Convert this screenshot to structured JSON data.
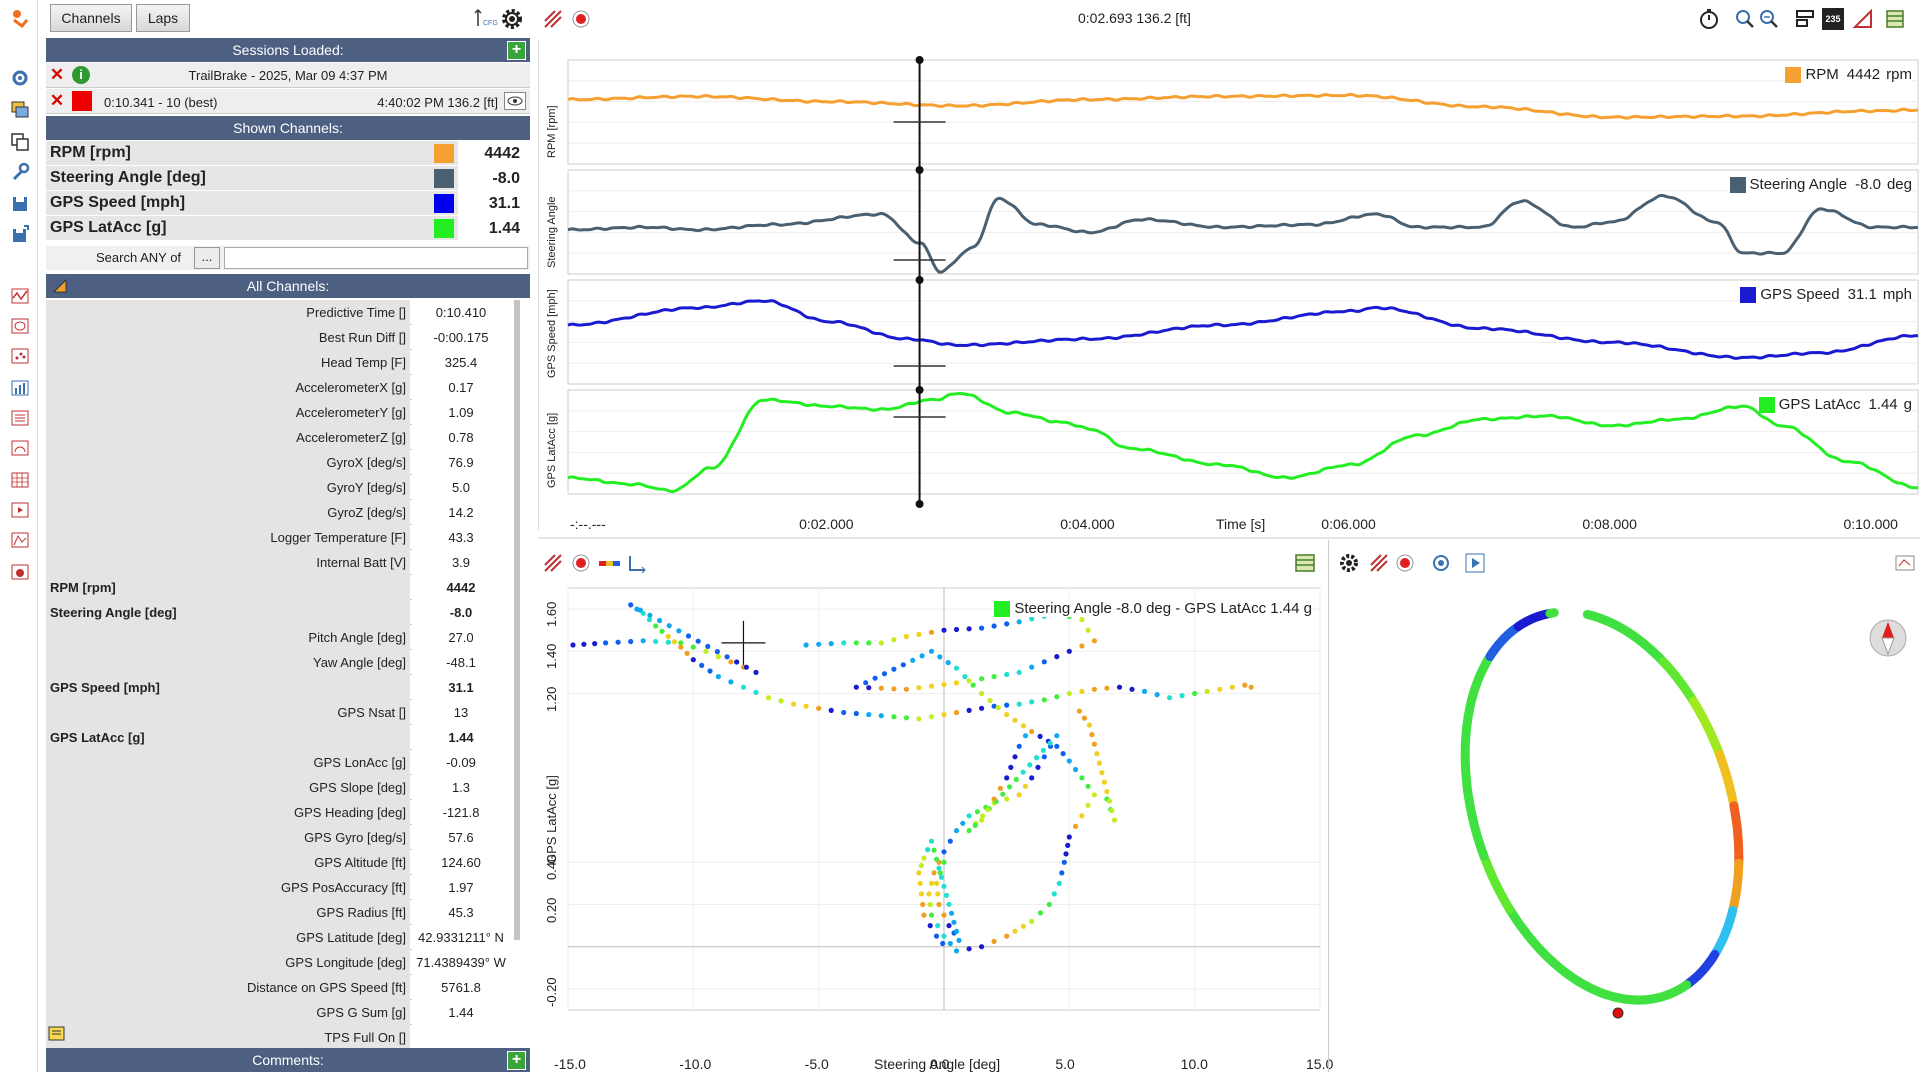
{
  "tabs": {
    "channels": "Channels",
    "laps": "Laps"
  },
  "cfg_label": "CFG",
  "sessions_header": "Sessions Loaded:",
  "session": {
    "name": "TrailBrake - 2025, Mar 09 4:37 PM",
    "lap": "0:10.341 - 10 (best)",
    "cursor": "4:40:02 PM 136.2 [ft]"
  },
  "shown_header": "Shown Channels:",
  "shown_channels": [
    {
      "name": "RPM [rpm]",
      "value": "4442",
      "color": "#f5a030"
    },
    {
      "name": "Steering Angle [deg]",
      "value": "-8.0",
      "color": "#4a6070"
    },
    {
      "name": "GPS Speed [mph]",
      "value": "31.1",
      "color": "#0000ee"
    },
    {
      "name": "GPS LatAcc [g]",
      "value": "1.44",
      "color": "#22ee22"
    }
  ],
  "search": {
    "label": "Search ANY of",
    "button": "...",
    "value": ""
  },
  "all_header": "All Channels:",
  "all_channels": [
    {
      "name": "Predictive Time []",
      "value": "0:10.410",
      "bold": false
    },
    {
      "name": "Best Run Diff []",
      "value": "-0:00.175",
      "bold": false
    },
    {
      "name": "Head Temp [F]",
      "value": "325.4",
      "bold": false
    },
    {
      "name": "AccelerometerX [g]",
      "value": "0.17",
      "bold": false
    },
    {
      "name": "AccelerometerY [g]",
      "value": "1.09",
      "bold": false
    },
    {
      "name": "AccelerometerZ [g]",
      "value": "0.78",
      "bold": false
    },
    {
      "name": "GyroX [deg/s]",
      "value": "76.9",
      "bold": false
    },
    {
      "name": "GyroY [deg/s]",
      "value": "5.0",
      "bold": false
    },
    {
      "name": "GyroZ [deg/s]",
      "value": "14.2",
      "bold": false
    },
    {
      "name": "Logger Temperature [F]",
      "value": "43.3",
      "bold": false
    },
    {
      "name": "Internal Batt [V]",
      "value": "3.9",
      "bold": false
    },
    {
      "name": "RPM [rpm]",
      "value": "4442",
      "bold": true
    },
    {
      "name": "Steering Angle [deg]",
      "value": "-8.0",
      "bold": true
    },
    {
      "name": "Pitch Angle [deg]",
      "value": "27.0",
      "bold": false
    },
    {
      "name": "Yaw Angle [deg]",
      "value": "-48.1",
      "bold": false
    },
    {
      "name": "GPS Speed [mph]",
      "value": "31.1",
      "bold": true
    },
    {
      "name": "GPS Nsat []",
      "value": "13",
      "bold": false
    },
    {
      "name": "GPS LatAcc [g]",
      "value": "1.44",
      "bold": true
    },
    {
      "name": "GPS LonAcc [g]",
      "value": "-0.09",
      "bold": false
    },
    {
      "name": "GPS Slope [deg]",
      "value": "1.3",
      "bold": false
    },
    {
      "name": "GPS Heading [deg]",
      "value": "-121.8",
      "bold": false
    },
    {
      "name": "GPS Gyro [deg/s]",
      "value": "57.6",
      "bold": false
    },
    {
      "name": "GPS Altitude [ft]",
      "value": "124.60",
      "bold": false
    },
    {
      "name": "GPS PosAccuracy [ft]",
      "value": "1.97",
      "bold": false
    },
    {
      "name": "GPS Radius [ft]",
      "value": "45.3",
      "bold": false
    },
    {
      "name": "GPS Latitude [deg]",
      "value": "42.9331211° N",
      "bold": false
    },
    {
      "name": "GPS Longitude [deg]",
      "value": "71.4389439° W",
      "bold": false
    },
    {
      "name": "Distance on GPS Speed [ft]",
      "value": "5761.8",
      "bold": false
    },
    {
      "name": "GPS G Sum [g]",
      "value": "1.44",
      "bold": false
    },
    {
      "name": "TPS Full On []",
      "value": "",
      "bold": false
    }
  ],
  "comments_header": "Comments:",
  "top_readout": "0:02.693 136.2 [ft]",
  "top_badge": "235",
  "time_plot": {
    "xlabel": "Time [s]",
    "x_ticks": [
      "-:--.---",
      "0:02.000",
      "0:04.000",
      "0:06.000",
      "0:08.000",
      "0:10.000"
    ],
    "xlim": [
      0,
      10.341
    ],
    "cursor_time": 2.693,
    "panels": [
      {
        "ylabel": "RPM [rpm]",
        "legend": {
          "name": "RPM",
          "value": "4442",
          "unit": "rpm"
        },
        "color": "#f5a030",
        "ylim": [
          4000,
          5000
        ]
      },
      {
        "ylabel": "Steering Angle",
        "legend": {
          "name": "Steering Angle",
          "value": "-8.0",
          "unit": "deg"
        },
        "color": "#4a6070",
        "ylim": [
          -20,
          20
        ]
      },
      {
        "ylabel": "GPS Speed [mph]",
        "legend": {
          "name": "GPS Speed",
          "value": "31.1",
          "unit": "mph"
        },
        "color": "#1a1ad0",
        "ylim": [
          25,
          40
        ]
      },
      {
        "ylabel": "GPS LatAcc [g]",
        "legend": {
          "name": "GPS LatAcc",
          "value": "1.44",
          "unit": "g"
        },
        "color": "#22ee22",
        "ylim": [
          0,
          1.6
        ]
      }
    ]
  },
  "chart_data": {
    "type": "scatter",
    "title": "",
    "legend": "Steering Angle -8.0 deg - GPS LatAcc 1.44 g",
    "legend_color": "#22ee22",
    "xlabel": "Steering Angle [deg]",
    "ylabel": "GPS LatAcc [g]",
    "xlim": [
      -15,
      15
    ],
    "ylim": [
      -0.3,
      1.7
    ],
    "x_ticks": [
      "-15.0",
      "-10.0",
      "-5.0",
      "0.0",
      "5.0",
      "10.0",
      "15.0"
    ],
    "y_ticks": [
      "-0.20",
      "0.20",
      "0.40",
      "1.20",
      "1.40",
      "1.60"
    ],
    "cursor": [
      -8.0,
      1.44
    ],
    "grid": true,
    "series": [
      {
        "color_by": "speed",
        "values": [
          [
            -14.8,
            1.43
          ],
          [
            -13.5,
            1.44
          ],
          [
            -12.0,
            1.45
          ],
          [
            -10.5,
            1.44
          ],
          [
            -9.5,
            1.4
          ],
          [
            -8.5,
            1.35
          ],
          [
            -7.5,
            1.3
          ],
          [
            -12.5,
            1.62
          ],
          [
            -12.0,
            1.58
          ],
          [
            -11.5,
            1.52
          ],
          [
            -11.0,
            1.47
          ],
          [
            -10.5,
            1.42
          ],
          [
            -10.0,
            1.36
          ],
          [
            -9.0,
            1.28
          ],
          [
            -8.0,
            1.23
          ],
          [
            -7.0,
            1.18
          ],
          [
            -6.0,
            1.15
          ],
          [
            -5.0,
            1.13
          ],
          [
            -4.0,
            1.11
          ],
          [
            -3.0,
            1.1
          ],
          [
            -2.0,
            1.09
          ],
          [
            -1.0,
            1.08
          ],
          [
            0.0,
            1.1
          ],
          [
            1.0,
            1.12
          ],
          [
            2.0,
            1.14
          ],
          [
            3.0,
            1.15
          ],
          [
            4.0,
            1.17
          ],
          [
            5.0,
            1.2
          ],
          [
            6.0,
            1.22
          ],
          [
            7.0,
            1.23
          ],
          [
            8.0,
            1.21
          ],
          [
            9.0,
            1.18
          ],
          [
            10.0,
            1.2
          ],
          [
            11.0,
            1.22
          ],
          [
            12.0,
            1.24
          ],
          [
            12.5,
            1.22
          ],
          [
            -5.5,
            1.43
          ],
          [
            -4.0,
            1.44
          ],
          [
            -2.5,
            1.44
          ],
          [
            -1.5,
            1.47
          ],
          [
            0.0,
            1.5
          ],
          [
            1.5,
            1.51
          ],
          [
            3.0,
            1.54
          ],
          [
            4.5,
            1.58
          ],
          [
            5.5,
            1.55
          ],
          [
            6.0,
            1.45
          ],
          [
            5.0,
            1.4
          ],
          [
            4.0,
            1.35
          ],
          [
            3.0,
            1.3
          ],
          [
            2.0,
            1.28
          ],
          [
            0.5,
            1.25
          ],
          [
            -1.5,
            1.22
          ],
          [
            -3.5,
            1.23
          ],
          [
            -0.5,
            1.4
          ],
          [
            0.5,
            1.32
          ],
          [
            1.5,
            1.2
          ],
          [
            2.5,
            1.1
          ],
          [
            3.5,
            1.02
          ],
          [
            4.5,
            0.95
          ],
          [
            5.0,
            0.88
          ],
          [
            5.5,
            0.8
          ],
          [
            6.0,
            0.72
          ],
          [
            5.5,
            0.62
          ],
          [
            5.0,
            0.52
          ],
          [
            4.8,
            0.4
          ],
          [
            4.6,
            0.3
          ],
          [
            4.2,
            0.2
          ],
          [
            3.5,
            0.12
          ],
          [
            2.5,
            0.05
          ],
          [
            1.5,
            0.0
          ],
          [
            0.5,
            -0.02
          ],
          [
            0.0,
            0.05
          ],
          [
            -0.5,
            0.15
          ],
          [
            -0.6,
            0.25
          ],
          [
            -0.4,
            0.35
          ],
          [
            0.0,
            0.45
          ],
          [
            0.5,
            0.55
          ],
          [
            1.0,
            0.62
          ],
          [
            2.0,
            0.68
          ],
          [
            3.0,
            0.72
          ],
          [
            3.5,
            0.8
          ],
          [
            4.0,
            0.9
          ],
          [
            4.5,
            1.0
          ],
          [
            1.0,
            0.55
          ],
          [
            1.5,
            0.6
          ],
          [
            2.0,
            0.7
          ],
          [
            2.5,
            0.8
          ],
          [
            3.0,
            0.95
          ],
          [
            3.5,
            1.05
          ],
          [
            0.0,
            0.4
          ],
          [
            -0.3,
            0.3
          ],
          [
            -0.2,
            0.2
          ],
          [
            0.2,
            0.1
          ],
          [
            0.6,
            0.03
          ],
          [
            -0.5,
            0.5
          ],
          [
            -0.8,
            0.42
          ],
          [
            -1.0,
            0.35
          ],
          [
            -0.8,
            0.15
          ],
          [
            -0.3,
            0.05
          ],
          [
            0.2,
            -0.02
          ],
          [
            6.5,
            0.7
          ],
          [
            6.8,
            0.6
          ],
          [
            5.8,
            1.05
          ],
          [
            5.2,
            1.15
          ]
        ]
      }
    ]
  },
  "track_map": {
    "start_marker_color": "#e01010"
  }
}
